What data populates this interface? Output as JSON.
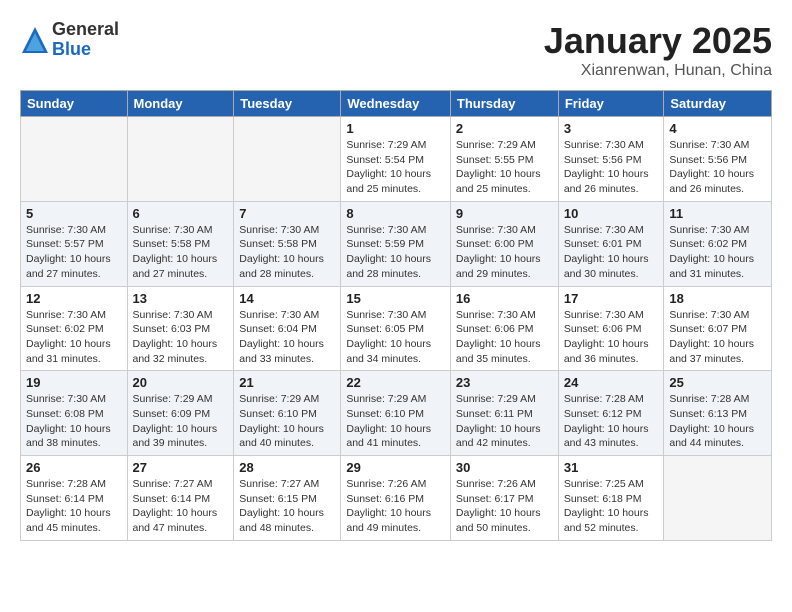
{
  "header": {
    "logo_general": "General",
    "logo_blue": "Blue",
    "month_title": "January 2025",
    "location": "Xianrenwan, Hunan, China"
  },
  "weekdays": [
    "Sunday",
    "Monday",
    "Tuesday",
    "Wednesday",
    "Thursday",
    "Friday",
    "Saturday"
  ],
  "weeks": [
    [
      {
        "day": "",
        "info": ""
      },
      {
        "day": "",
        "info": ""
      },
      {
        "day": "",
        "info": ""
      },
      {
        "day": "1",
        "info": "Sunrise: 7:29 AM\nSunset: 5:54 PM\nDaylight: 10 hours\nand 25 minutes."
      },
      {
        "day": "2",
        "info": "Sunrise: 7:29 AM\nSunset: 5:55 PM\nDaylight: 10 hours\nand 25 minutes."
      },
      {
        "day": "3",
        "info": "Sunrise: 7:30 AM\nSunset: 5:56 PM\nDaylight: 10 hours\nand 26 minutes."
      },
      {
        "day": "4",
        "info": "Sunrise: 7:30 AM\nSunset: 5:56 PM\nDaylight: 10 hours\nand 26 minutes."
      }
    ],
    [
      {
        "day": "5",
        "info": "Sunrise: 7:30 AM\nSunset: 5:57 PM\nDaylight: 10 hours\nand 27 minutes."
      },
      {
        "day": "6",
        "info": "Sunrise: 7:30 AM\nSunset: 5:58 PM\nDaylight: 10 hours\nand 27 minutes."
      },
      {
        "day": "7",
        "info": "Sunrise: 7:30 AM\nSunset: 5:58 PM\nDaylight: 10 hours\nand 28 minutes."
      },
      {
        "day": "8",
        "info": "Sunrise: 7:30 AM\nSunset: 5:59 PM\nDaylight: 10 hours\nand 28 minutes."
      },
      {
        "day": "9",
        "info": "Sunrise: 7:30 AM\nSunset: 6:00 PM\nDaylight: 10 hours\nand 29 minutes."
      },
      {
        "day": "10",
        "info": "Sunrise: 7:30 AM\nSunset: 6:01 PM\nDaylight: 10 hours\nand 30 minutes."
      },
      {
        "day": "11",
        "info": "Sunrise: 7:30 AM\nSunset: 6:02 PM\nDaylight: 10 hours\nand 31 minutes."
      }
    ],
    [
      {
        "day": "12",
        "info": "Sunrise: 7:30 AM\nSunset: 6:02 PM\nDaylight: 10 hours\nand 31 minutes."
      },
      {
        "day": "13",
        "info": "Sunrise: 7:30 AM\nSunset: 6:03 PM\nDaylight: 10 hours\nand 32 minutes."
      },
      {
        "day": "14",
        "info": "Sunrise: 7:30 AM\nSunset: 6:04 PM\nDaylight: 10 hours\nand 33 minutes."
      },
      {
        "day": "15",
        "info": "Sunrise: 7:30 AM\nSunset: 6:05 PM\nDaylight: 10 hours\nand 34 minutes."
      },
      {
        "day": "16",
        "info": "Sunrise: 7:30 AM\nSunset: 6:06 PM\nDaylight: 10 hours\nand 35 minutes."
      },
      {
        "day": "17",
        "info": "Sunrise: 7:30 AM\nSunset: 6:06 PM\nDaylight: 10 hours\nand 36 minutes."
      },
      {
        "day": "18",
        "info": "Sunrise: 7:30 AM\nSunset: 6:07 PM\nDaylight: 10 hours\nand 37 minutes."
      }
    ],
    [
      {
        "day": "19",
        "info": "Sunrise: 7:30 AM\nSunset: 6:08 PM\nDaylight: 10 hours\nand 38 minutes."
      },
      {
        "day": "20",
        "info": "Sunrise: 7:29 AM\nSunset: 6:09 PM\nDaylight: 10 hours\nand 39 minutes."
      },
      {
        "day": "21",
        "info": "Sunrise: 7:29 AM\nSunset: 6:10 PM\nDaylight: 10 hours\nand 40 minutes."
      },
      {
        "day": "22",
        "info": "Sunrise: 7:29 AM\nSunset: 6:10 PM\nDaylight: 10 hours\nand 41 minutes."
      },
      {
        "day": "23",
        "info": "Sunrise: 7:29 AM\nSunset: 6:11 PM\nDaylight: 10 hours\nand 42 minutes."
      },
      {
        "day": "24",
        "info": "Sunrise: 7:28 AM\nSunset: 6:12 PM\nDaylight: 10 hours\nand 43 minutes."
      },
      {
        "day": "25",
        "info": "Sunrise: 7:28 AM\nSunset: 6:13 PM\nDaylight: 10 hours\nand 44 minutes."
      }
    ],
    [
      {
        "day": "26",
        "info": "Sunrise: 7:28 AM\nSunset: 6:14 PM\nDaylight: 10 hours\nand 45 minutes."
      },
      {
        "day": "27",
        "info": "Sunrise: 7:27 AM\nSunset: 6:14 PM\nDaylight: 10 hours\nand 47 minutes."
      },
      {
        "day": "28",
        "info": "Sunrise: 7:27 AM\nSunset: 6:15 PM\nDaylight: 10 hours\nand 48 minutes."
      },
      {
        "day": "29",
        "info": "Sunrise: 7:26 AM\nSunset: 6:16 PM\nDaylight: 10 hours\nand 49 minutes."
      },
      {
        "day": "30",
        "info": "Sunrise: 7:26 AM\nSunset: 6:17 PM\nDaylight: 10 hours\nand 50 minutes."
      },
      {
        "day": "31",
        "info": "Sunrise: 7:25 AM\nSunset: 6:18 PM\nDaylight: 10 hours\nand 52 minutes."
      },
      {
        "day": "",
        "info": ""
      }
    ]
  ]
}
